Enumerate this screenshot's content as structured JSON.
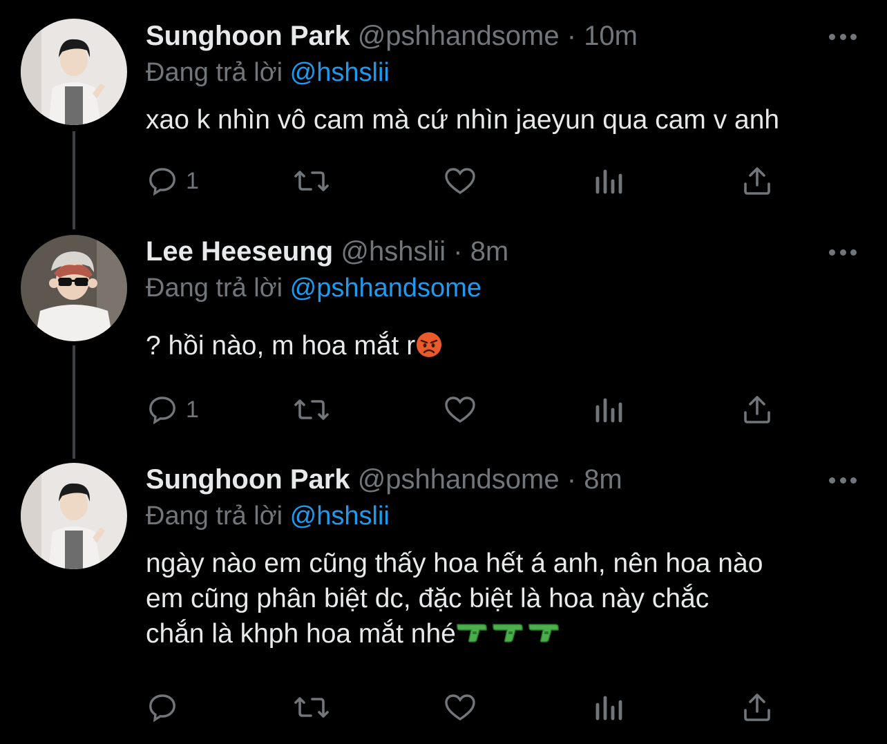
{
  "thread": {
    "line_color": "#3e4144",
    "accent_color": "#1d9bf0",
    "muted_color": "#71767b"
  },
  "tweets": [
    {
      "display_name": "Sunghoon Park",
      "handle": "@pshhandsome",
      "separator": "·",
      "time": "10m",
      "reply_label": "Đang trả lời",
      "reply_handle": "@hshslii",
      "text_lines": [
        "xao k nhìn vô cam mà cứ nhìn jaeyun qua cam v anh"
      ],
      "reply_count": "1",
      "avatar_icon": "avatar-photo",
      "more_icon": "more-dots-icon"
    },
    {
      "display_name": "Lee Heeseung",
      "handle": "@hshslii",
      "separator": "·",
      "time": "8m",
      "reply_label": "Đang trả lời",
      "reply_handle": "@pshhandsome",
      "text_lines": [
        "? hồi nào, m hoa mắt r"
      ],
      "emoji": "angry-face-emoji",
      "reply_count": "1",
      "avatar_icon": "avatar-photo",
      "more_icon": "more-dots-icon"
    },
    {
      "display_name": "Sunghoon Park",
      "handle": "@pshhandsome",
      "separator": "·",
      "time": "8m",
      "reply_label": "Đang trả lời",
      "reply_handle": "@hshslii",
      "text_lines": [
        "ngày nào em cũng thấy hoa hết á anh, nên hoa nào",
        "em cũng phân biệt dc, đặc biệt là hoa này chắc",
        "chắn là khph hoa mắt nhé"
      ],
      "emoji": "water-pistol-emoji",
      "emoji_count": 3,
      "reply_count": "",
      "avatar_icon": "avatar-photo",
      "more_icon": "more-dots-icon"
    }
  ],
  "action_icons": [
    "reply-icon",
    "retweet-icon",
    "like-icon",
    "analytics-icon",
    "share-icon"
  ]
}
